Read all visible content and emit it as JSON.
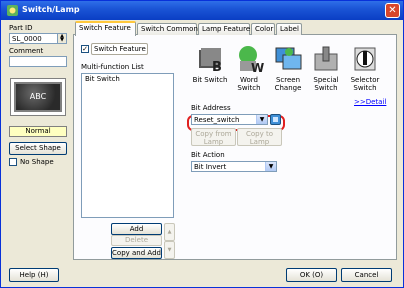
{
  "window": {
    "title": "Switch/Lamp"
  },
  "left": {
    "part_id_label": "Part ID",
    "part_id_value": "SL_0000",
    "comment_label": "Comment",
    "comment_value": "",
    "lamp_text": "ABC",
    "state_text": "Normal",
    "select_shape_label": "Select Shape",
    "no_shape_label": "No Shape",
    "no_shape_checked": false
  },
  "tabs": [
    "Switch Feature",
    "Switch Common",
    "Lamp Feature",
    "Color",
    "Label"
  ],
  "active_tab": "Switch Feature",
  "feature": {
    "switch_feature_label": "Switch Feature",
    "switch_feature_checked": true,
    "list_label": "Multi-function List",
    "list_items": [
      "Bit Switch"
    ],
    "add_label": "Add",
    "delete_label": "Delete",
    "copy_add_label": "Copy and Add",
    "up_arrow": "▲",
    "down_arrow": "▼"
  },
  "switch_types": [
    {
      "line1": "Bit Switch",
      "line2": "",
      "icon": "bit-switch-icon"
    },
    {
      "line1": "Word",
      "line2": "Switch",
      "icon": "word-switch-icon"
    },
    {
      "line1": "Screen",
      "line2": "Change",
      "icon": "screen-change-icon"
    },
    {
      "line1": "Special",
      "line2": "Switch",
      "icon": "special-switch-icon"
    },
    {
      "line1": "Selector",
      "line2": "Switch",
      "icon": "selector-switch-icon"
    }
  ],
  "detail_link": ">>Detail",
  "bit_address": {
    "label": "Bit Address",
    "value": "Reset_switch",
    "copy_from_lamp": [
      "Copy from",
      "Lamp"
    ],
    "copy_to_lamp": [
      "Copy to",
      "Lamp"
    ]
  },
  "bit_action": {
    "label": "Bit Action",
    "value": "Bit Invert"
  },
  "footer": {
    "help_label": "Help (H)",
    "ok_label": "OK (O)",
    "cancel_label": "Cancel"
  },
  "colors": {
    "title_bar": "#0a3ec4",
    "highlight": "#e02020",
    "state_bg": "#ffffc0"
  }
}
